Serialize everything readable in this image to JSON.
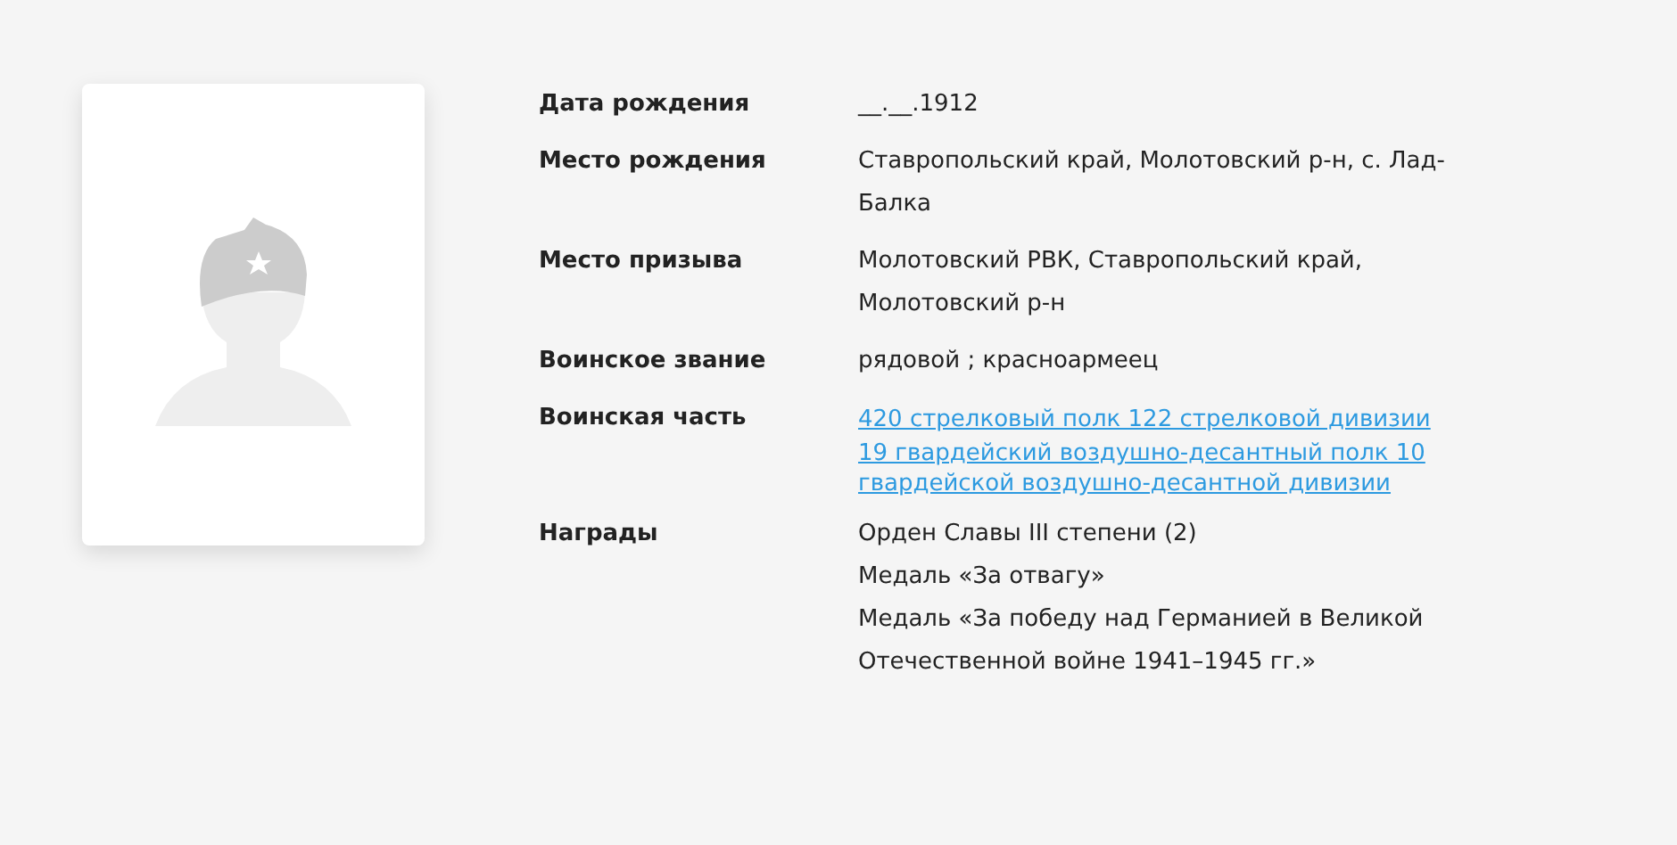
{
  "rows": [
    {
      "label": "Дата рождения",
      "values": [
        {
          "kind": "text",
          "text": "__.__.1912"
        }
      ]
    },
    {
      "label": "Место рождения",
      "values": [
        {
          "kind": "text",
          "text": "Ставропольский край, Молотовский р-н, с. Лад-Балка"
        }
      ]
    },
    {
      "label": "Место призыва",
      "values": [
        {
          "kind": "text",
          "text": "Молотовский РВК, Ставропольский край, Молотовский р-н"
        }
      ]
    },
    {
      "label": "Воинское звание",
      "values": [
        {
          "kind": "text",
          "text": "рядовой ; красноармеец"
        }
      ]
    },
    {
      "label": "Воинская часть",
      "values": [
        {
          "kind": "link",
          "text": "420 стрелковый полк 122 стрелковой дивизии"
        },
        {
          "kind": "link",
          "text": "19 гвардейский воздушно-десантный полк 10 гвардейской воздушно-десантной дивизии"
        }
      ]
    },
    {
      "label": "Награды",
      "values": [
        {
          "kind": "text",
          "text": "Орден Славы III степени (2)"
        },
        {
          "kind": "text",
          "text": "Медаль «За отвагу»"
        },
        {
          "kind": "text",
          "text": "Медаль «За победу над Германией в Великой Отечественной войне 1941–1945 гг.»"
        }
      ]
    }
  ]
}
